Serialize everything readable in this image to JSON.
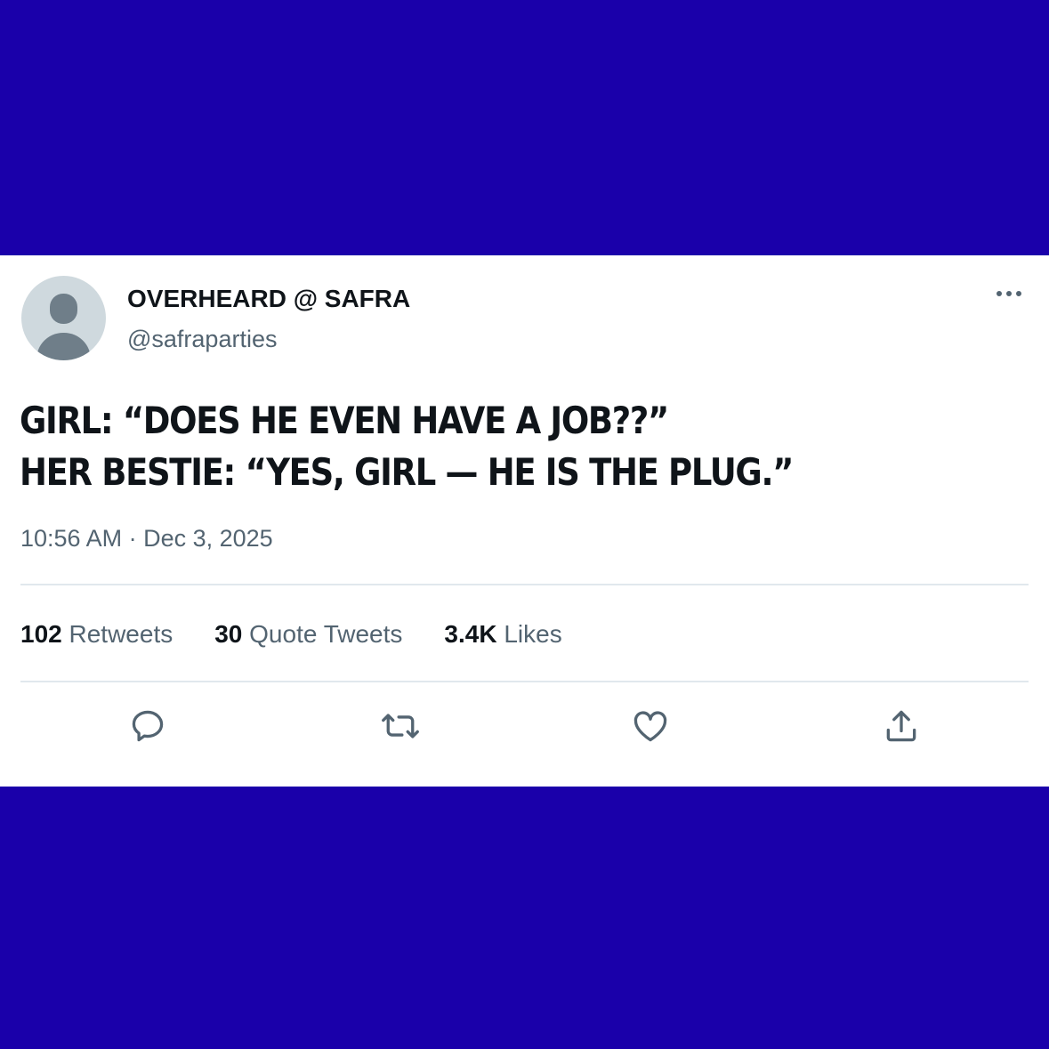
{
  "tweet": {
    "display_name": "OVERHEARD @ SAFRA",
    "handle": "@safraparties",
    "text_lines": [
      "GIRL: “DOES HE EVEN HAVE A JOB??”",
      "HER BESTIE: “YES, GIRL — HE IS THE PLUG.”"
    ],
    "timestamp": "10:56 AM · Dec 3, 2025",
    "stats": {
      "retweets": {
        "count": "102",
        "label": "Retweets"
      },
      "quote_tweets": {
        "count": "30",
        "label": "Quote Tweets"
      },
      "likes": {
        "count": "3.4K",
        "label": "Likes"
      }
    },
    "actions": [
      "reply-icon",
      "retweet-icon",
      "like-icon",
      "share-icon"
    ]
  },
  "colors": {
    "background": "#1a00aa",
    "card": "#ffffff",
    "primary_text": "#0f1419",
    "secondary_text": "#536471",
    "divider": "#e1e8ed"
  }
}
